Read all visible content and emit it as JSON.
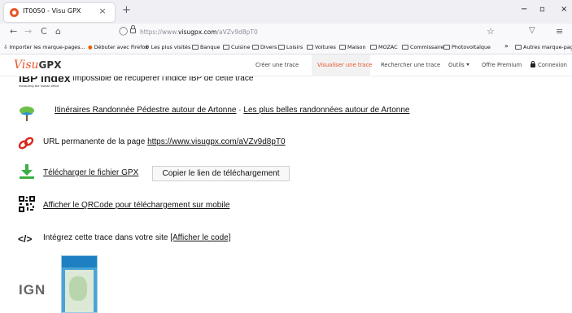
{
  "browser": {
    "tab_title": "IT0050 - Visu GPX",
    "tab_close": "×",
    "new_tab": "+",
    "window_controls": [
      "−",
      "▫",
      "×"
    ],
    "nav": {
      "back": "←",
      "forward": "→",
      "reload": "C",
      "home": "⌂"
    },
    "url_prefix": "https://www.",
    "url_domain": "visugpx.com",
    "url_path": "/aVZv9d8pT0",
    "star": "☆",
    "pocket": "▽",
    "menu": "≡"
  },
  "bookmarks": {
    "items": [
      "Importer les marque-pages...",
      "Débuter avec Firefox",
      "Les plus visités",
      "Banque",
      "Cuisine",
      "Divers",
      "Loisirs",
      "Voitures",
      "Maison",
      "MOZAC",
      "Commissaire",
      "Photovoltaïque"
    ],
    "overflow": "»",
    "other": "Autres marque-pages"
  },
  "site": {
    "logo_visu": "Visu",
    "logo_gpx": "GPX",
    "menu": {
      "create": "Créer une trace",
      "view": "Visualiser une trace",
      "search": "Rechercher une trace",
      "tools": "Outils",
      "premium": "Offre Premium",
      "login": "Connexion"
    }
  },
  "content": {
    "ibp_logo": "IBP index",
    "ibp_tagline": "measuring the human effort",
    "ibp_text": "Impossible de récupérer l'indice IBP de cette trace",
    "itineraries_link": "Itinéraires Randonnée Pédestre autour de Artonne",
    "itineraries_sep": "·",
    "best_hikes_link": "Les plus belles randonnées autour de Artonne",
    "permalink_label": "URL permanente de la page",
    "permalink_url": "https://www.visugpx.com/aVZv9d8pT0",
    "download_link": "Télécharger le fichier GPX",
    "copy_button": "Copier le lien de téléchargement",
    "qrcode_link": "Afficher le QRCode pour téléchargement sur mobile",
    "embed_icon": "</>",
    "embed_text": "Intégrez cette trace dans votre site",
    "embed_link": "[Afficher le code]",
    "ign_logo": "IGN"
  },
  "colors": {
    "accent": "#e8562a",
    "download_green": "#3cb043",
    "chain_red": "#d9261c"
  }
}
